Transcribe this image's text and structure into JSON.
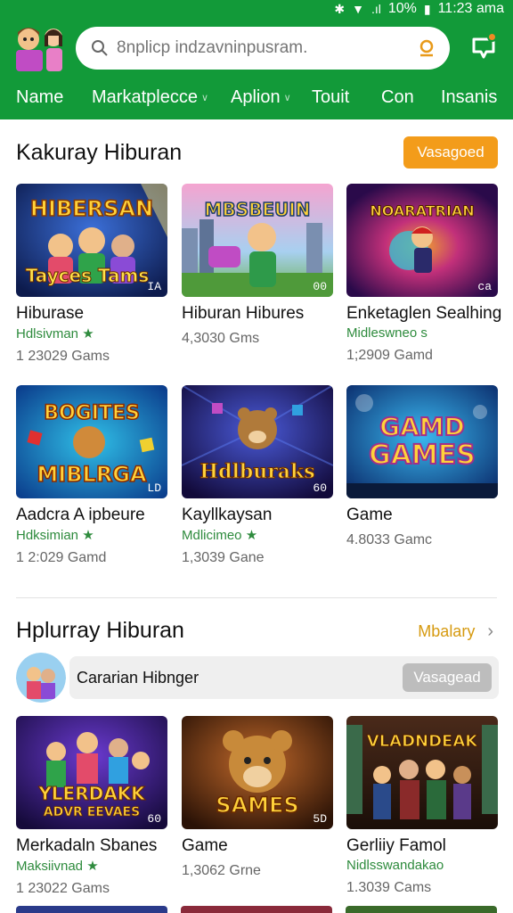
{
  "status": {
    "battery": "10%",
    "time": "11:23 ama"
  },
  "search": {
    "placeholder": "8nplicp indzavninpusram."
  },
  "nav": {
    "items": [
      {
        "label": "Name"
      },
      {
        "label": "Markatplecce"
      },
      {
        "label": "Aplion"
      },
      {
        "label": "Touit"
      },
      {
        "label": "Con"
      },
      {
        "label": "Insanis"
      }
    ]
  },
  "section1": {
    "title": "Kakuray Hiburan",
    "button": "Vasagoed",
    "cards": [
      {
        "art": "HIBERSAN",
        "art2": "Tayces Tams",
        "badge": "IA",
        "title": "Hiburase",
        "subtitle": "Hdlsivman",
        "count": "1 23029 Gams"
      },
      {
        "art": "MBSBEUIN",
        "art2": "",
        "badge": "00",
        "title": "Hiburan Hibures",
        "subtitle": "",
        "count": "4,3030 Gms"
      },
      {
        "art": "NOARATRIAN",
        "art2": "",
        "badge": "ca",
        "title": "Enketaglen Sealhing",
        "subtitle": "Midleswneo s",
        "count": "1;2909 Gamd"
      },
      {
        "art": "BOGITES",
        "art2": "MIBLRGA",
        "badge": "LD",
        "title": "Aadcra A ipbeure",
        "subtitle": "Hdksimian",
        "count": "1 2:029 Gamd"
      },
      {
        "art": "Hdlburaks",
        "art2": "",
        "badge": "60",
        "title": "Kayllkaysan",
        "subtitle": "Mdlicimeo",
        "count": "1,3039 Gane"
      },
      {
        "art": "GAMD",
        "art2": "GAMES",
        "badge": "",
        "title": "Game",
        "subtitle": "",
        "count": "4.8033 Gamc"
      }
    ]
  },
  "section2": {
    "title": "Hplurray Hiburan",
    "more": "Mbalary",
    "banner_text": "Cararian Hibnger",
    "banner_button": "Vasagead",
    "cards": [
      {
        "art": "YLERDAKK",
        "art2": "ADVR EEVAES",
        "badge": "60",
        "title": "Merkadaln Sbanes",
        "subtitle": "Maksiivnad",
        "count": "1 23022 Gams"
      },
      {
        "art": "SAMES",
        "art2": "",
        "badge": "5D",
        "title": "Game",
        "subtitle": "",
        "count": "1,3062 Grne"
      },
      {
        "art": "VLADNDEAK",
        "art2": "",
        "badge": "",
        "title": "Gerliiy Famol",
        "subtitle": "Nidlsswandakao",
        "count": "1.3039 Cams"
      }
    ]
  },
  "colors": {
    "header_green": "#129a39",
    "accent_orange": "#f39c1a",
    "subtitle_green": "#2e8b3d"
  }
}
